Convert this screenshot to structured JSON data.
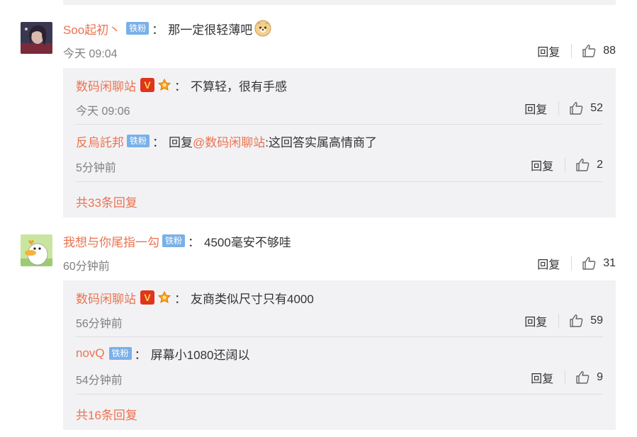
{
  "reply_label": "回复",
  "fan_badge_label": "铁粉",
  "colon": "：",
  "v_label": "V",
  "comments": [
    {
      "username": "Soo起初丶",
      "text": "那一定很轻薄吧",
      "emoji": "doge-emoji",
      "time": "今天 09:04",
      "likes": "88",
      "replies": [
        {
          "username": "数码闲聊站",
          "text": "不算轻，很有手感",
          "time": "今天 09:06",
          "likes": "52"
        },
        {
          "username": "反烏託邦",
          "text_prefix": "回复",
          "mention": "@数码闲聊站",
          "text": ":这回答实属高情商了",
          "time": "5分钟前",
          "likes": "2"
        }
      ],
      "more_replies": "共33条回复"
    },
    {
      "username": "我想与你尾指一勾",
      "text": "4500毫安不够哇",
      "time": "60分钟前",
      "likes": "31",
      "replies": [
        {
          "username": "数码闲聊站",
          "text": "友商类似尺寸只有4000",
          "time": "56分钟前",
          "likes": "59"
        },
        {
          "username": "novQ",
          "text": "屏幕小1080还阔以",
          "time": "54分钟前",
          "likes": "9"
        }
      ],
      "more_replies": "共16条回复"
    }
  ],
  "colors": {
    "username": "#eb7350",
    "fan_badge": "#7ab0e8",
    "sub_bg": "#f2f2f5",
    "time": "#808080"
  }
}
